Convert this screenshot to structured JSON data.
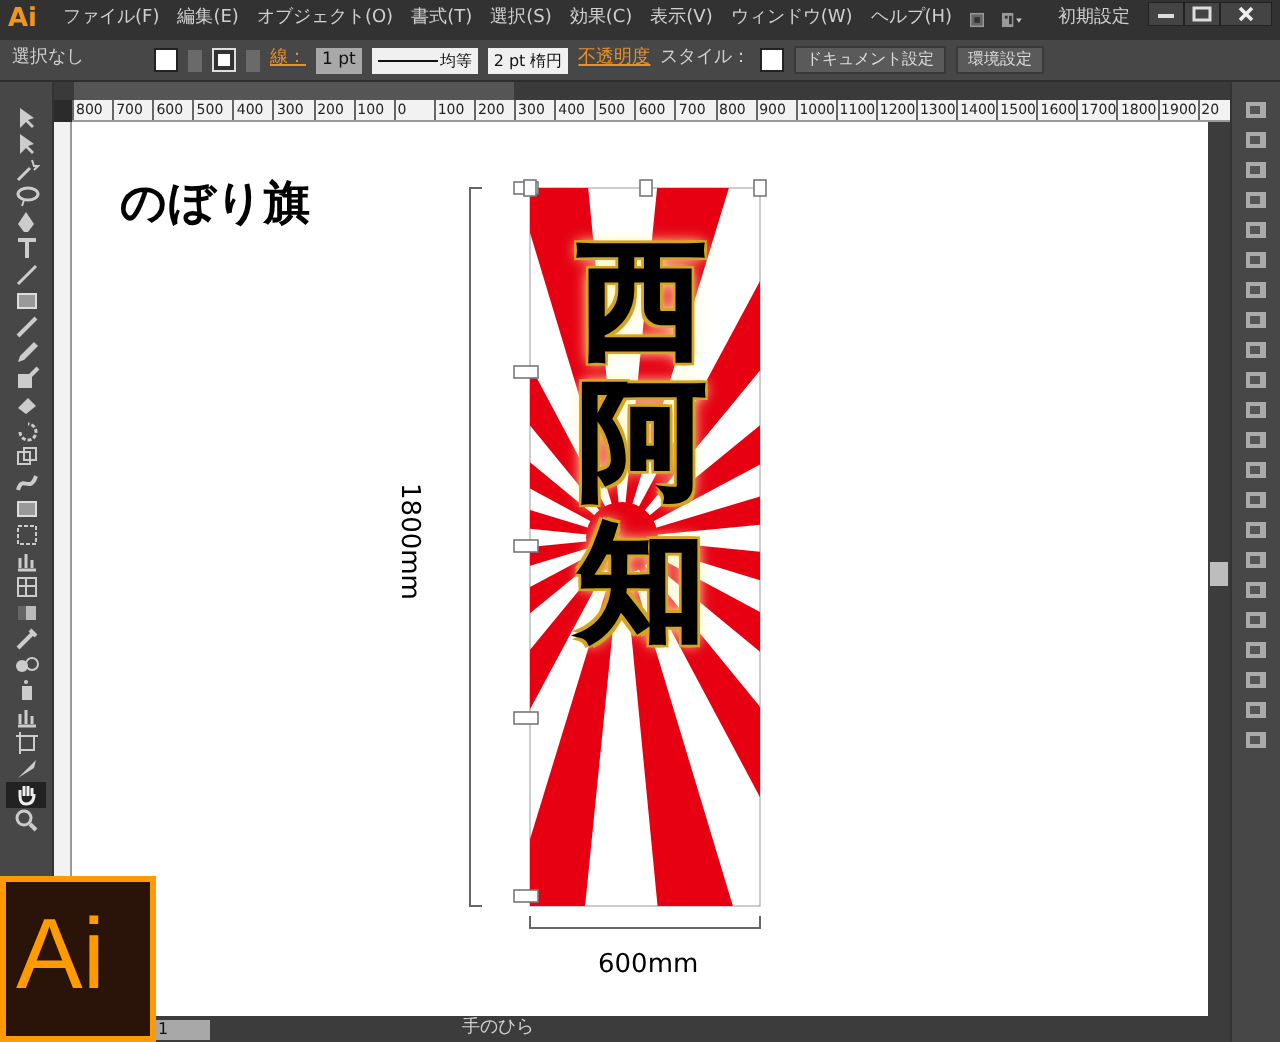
{
  "menu_bar": {
    "logo": "Ai",
    "items": [
      "ファイル(F)",
      "編集(E)",
      "オブジェクト(O)",
      "書式(T)",
      "選択(S)",
      "効果(C)",
      "表示(V)",
      "ウィンドウ(W)",
      "ヘルプ(H)"
    ],
    "workspace": "初期設定"
  },
  "control_bar": {
    "selection": "選択なし",
    "stroke_label": "線：",
    "stroke_weight": "1 pt",
    "stroke_profile": "均等",
    "brush": "2 pt 楕円",
    "opacity_label": "不透明度",
    "style_label": "スタイル：",
    "buttons": [
      "ドキュメント設定",
      "環境設定"
    ]
  },
  "ruler_labels": [
    "800",
    "700",
    "600",
    "500",
    "400",
    "300",
    "200",
    "100",
    "0",
    "100",
    "200",
    "300",
    "400",
    "500",
    "600",
    "700",
    "800",
    "900",
    "1000",
    "1100",
    "1200",
    "1300",
    "1400",
    "1500",
    "1600",
    "1700",
    "1800",
    "1900",
    "20"
  ],
  "tools": [
    {
      "kind": "arrow",
      "selected": false
    },
    {
      "kind": "arrow",
      "selected": false
    },
    {
      "kind": "wand",
      "selected": false
    },
    {
      "kind": "lasso",
      "selected": false
    },
    {
      "kind": "pen",
      "selected": false
    },
    {
      "kind": "type",
      "selected": false
    },
    {
      "kind": "line",
      "selected": false
    },
    {
      "kind": "rect",
      "selected": false
    },
    {
      "kind": "brush",
      "selected": false
    },
    {
      "kind": "pencil",
      "selected": false
    },
    {
      "kind": "blob",
      "selected": false
    },
    {
      "kind": "eraser",
      "selected": false
    },
    {
      "kind": "rotate",
      "selected": false
    },
    {
      "kind": "scale",
      "selected": false
    },
    {
      "kind": "warp",
      "selected": false
    },
    {
      "kind": "rect",
      "selected": false
    },
    {
      "kind": "shape",
      "selected": false
    },
    {
      "kind": "graph",
      "selected": false
    },
    {
      "kind": "mesh",
      "selected": false
    },
    {
      "kind": "gradient",
      "selected": false
    },
    {
      "kind": "eyedropper",
      "selected": false
    },
    {
      "kind": "blend",
      "selected": false
    },
    {
      "kind": "spray",
      "selected": false
    },
    {
      "kind": "graph",
      "selected": false
    },
    {
      "kind": "artboard",
      "selected": false
    },
    {
      "kind": "knife",
      "selected": false
    },
    {
      "kind": "hand",
      "selected": true
    },
    {
      "kind": "zoom",
      "selected": false
    }
  ],
  "artboard": {
    "title": "のぼり旗",
    "banner_text": "西阿知",
    "height_label": "1800mm",
    "width_label": "600mm"
  },
  "status_bar": {
    "zoom": "1",
    "tool": "手のひら"
  },
  "badge": {
    "text": "Ai"
  }
}
